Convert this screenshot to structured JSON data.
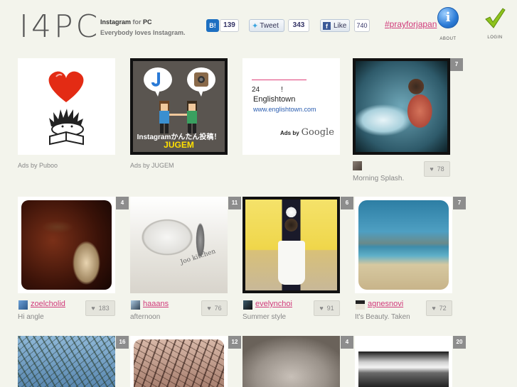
{
  "header": {
    "logo": "I4PC",
    "tagline_line1_a": "Instagram",
    "tagline_line1_b": "for",
    "tagline_line1_c": "PC",
    "tagline_line2": "Everybody loves Instagram.",
    "share": {
      "hatena_count": "139",
      "tweet_label": "Tweet",
      "tweet_count": "343",
      "like_label": "Like",
      "like_count": "740"
    },
    "hashtag": "#prayforjapan",
    "about_label": "ABOUT",
    "login_label": "LOGIN"
  },
  "ads": [
    {
      "label": "Ads by Puboo"
    },
    {
      "label": "Ads by JUGEM",
      "banner_text": "Instagramかんたん投稿！",
      "brand": "JUGEM"
    },
    {
      "line1": "24　　　!",
      "line2": "Englishtown",
      "url": "www.englishtown.com",
      "ads_by": "Ads by",
      "google": "Google"
    }
  ],
  "photos": [
    {
      "count": "7",
      "user": "",
      "caption": "Morning Splash.",
      "likes": "78"
    },
    {
      "count": "4",
      "user": "zoelcholid",
      "caption": "Hi angle",
      "likes": "183"
    },
    {
      "count": "11",
      "user": "haaans",
      "caption": "afternoon",
      "likes": "76"
    },
    {
      "count": "6",
      "user": "evelynchoi",
      "caption": "Summer style",
      "likes": "91"
    },
    {
      "count": "7",
      "user": "agnesnovi",
      "caption": "It's Beauty. Taken",
      "likes": "72"
    },
    {
      "count": "16"
    },
    {
      "count": "12"
    },
    {
      "count": "4"
    },
    {
      "count": "20"
    }
  ],
  "colors": {
    "accent": "#d03a7a",
    "background": "#f3f4ec",
    "badge": "#8d8d8d"
  }
}
